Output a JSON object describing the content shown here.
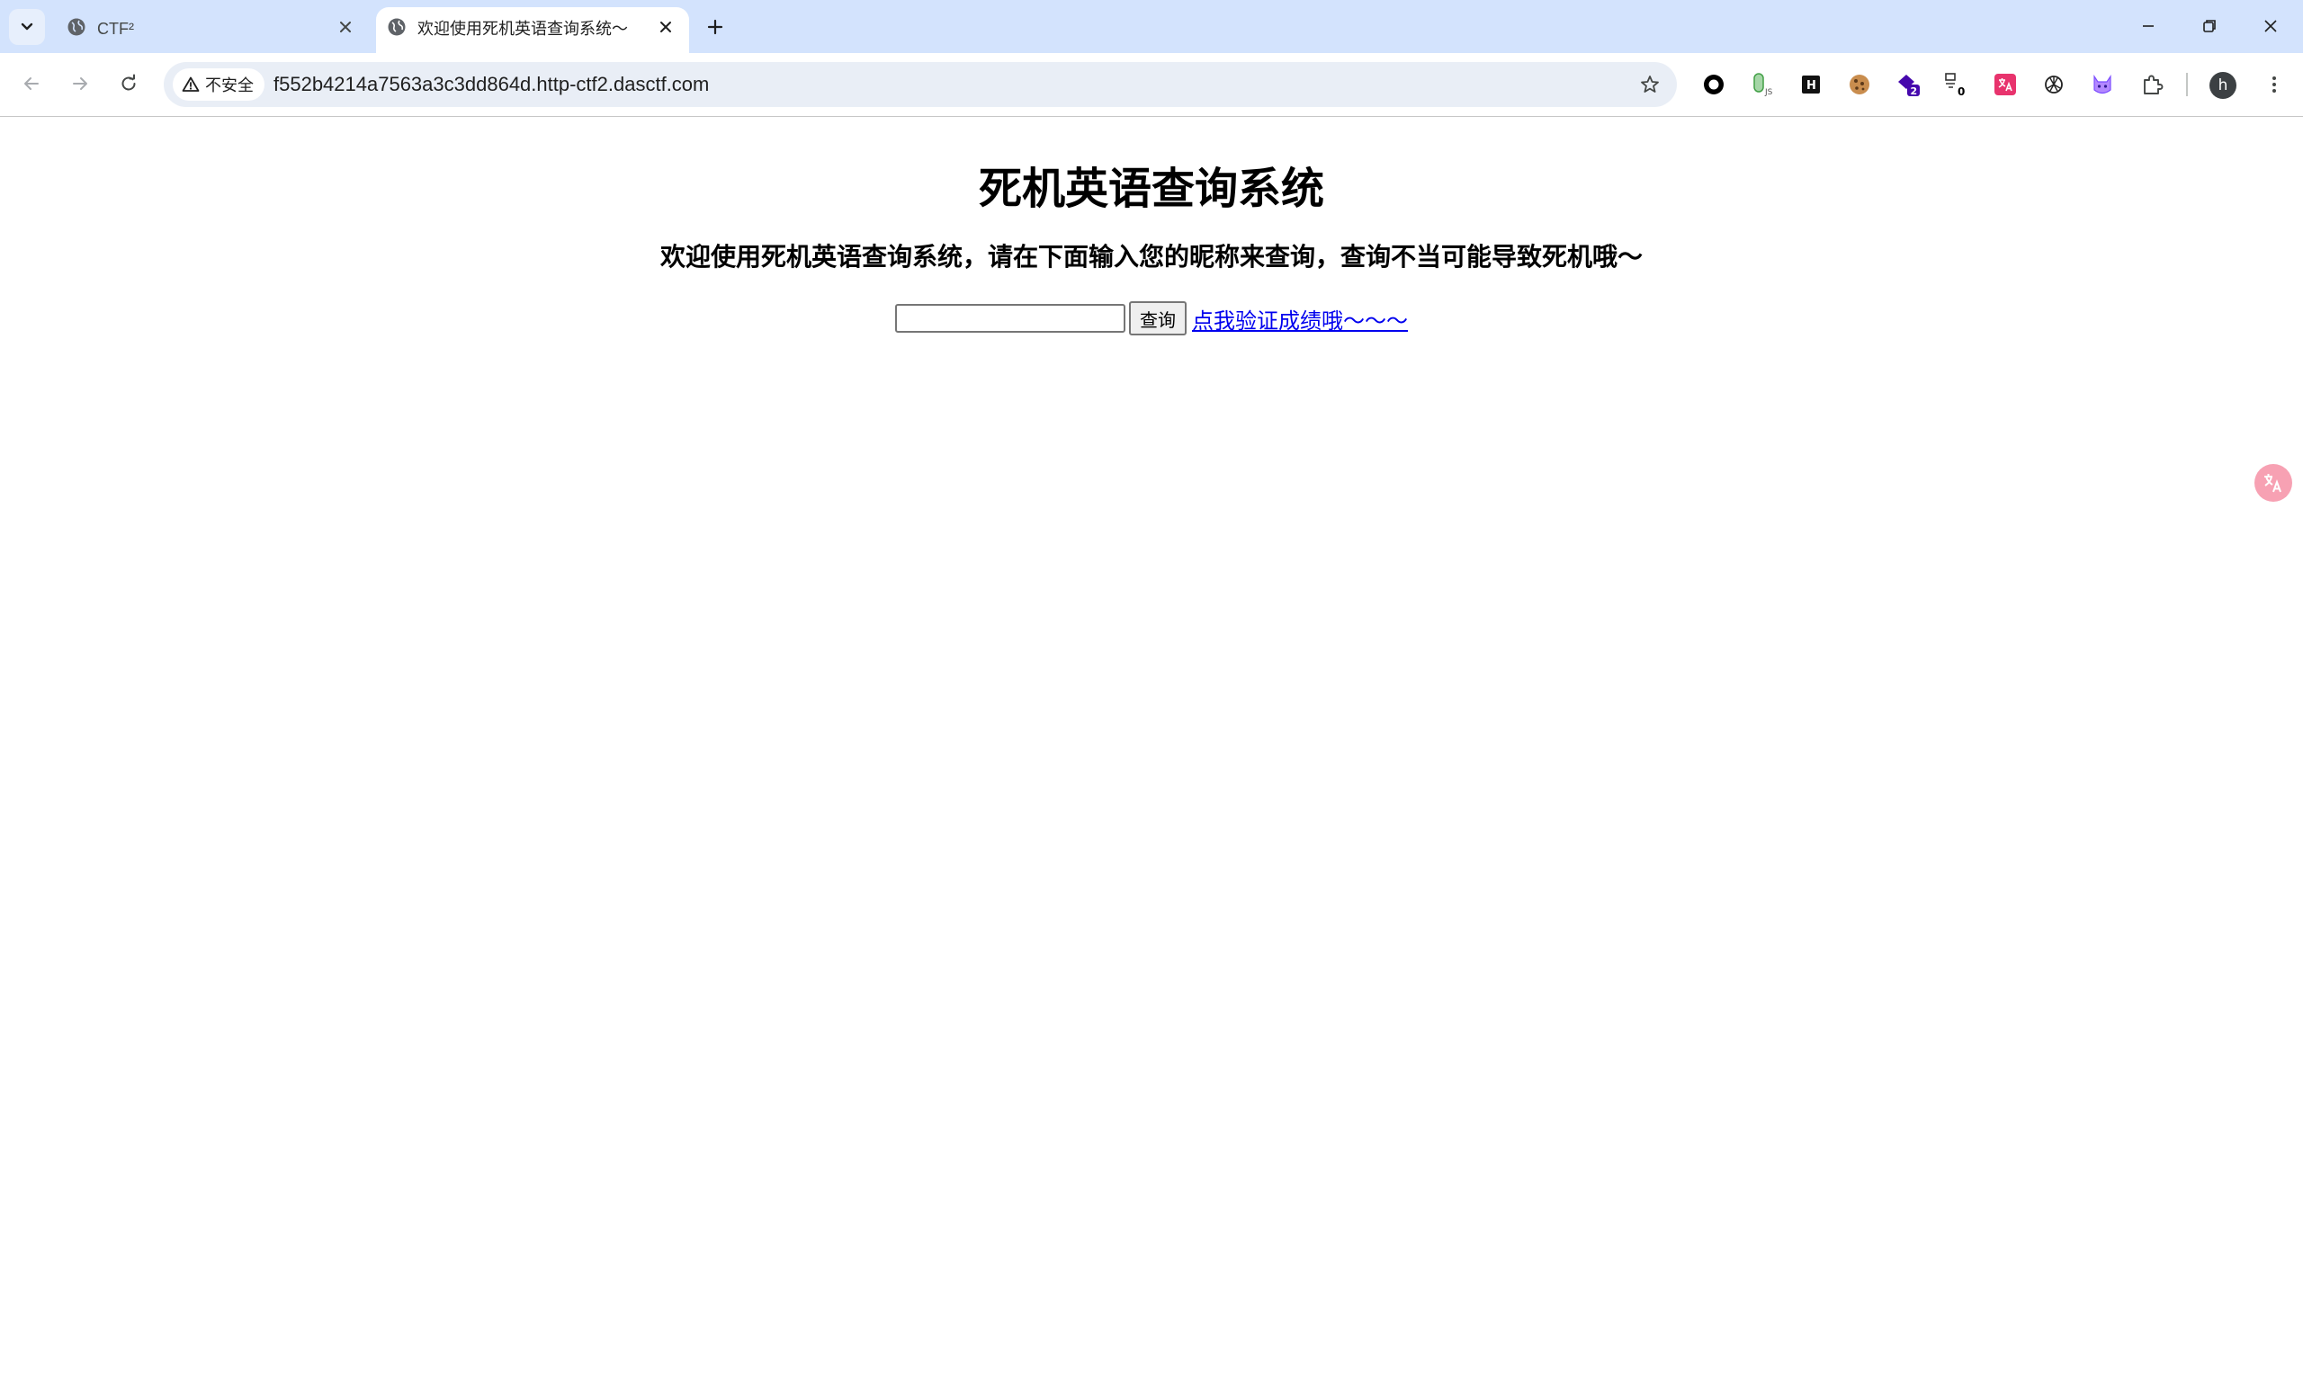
{
  "browser": {
    "tabs": [
      {
        "title": "CTF²",
        "active": false,
        "icon": "globe-icon"
      },
      {
        "title": "欢迎使用死机英语查询系统～",
        "active": true,
        "icon": "globe-icon"
      }
    ],
    "address_bar": {
      "security_label": "不安全",
      "url": "f552b4214a7563a3c3dd864d.http-ctf2.dasctf.com"
    },
    "extensions": [
      {
        "icon": "circle-record-icon"
      },
      {
        "icon": "nodejs-icon"
      },
      {
        "icon": "hackbar-icon"
      },
      {
        "icon": "cookie-icon"
      },
      {
        "icon": "wappalyzer-icon",
        "badge": "2"
      },
      {
        "icon": "proxy-icon",
        "badge": "0"
      },
      {
        "icon": "translate-icon"
      },
      {
        "icon": "openai-icon"
      },
      {
        "icon": "cat-icon"
      },
      {
        "icon": "puzzle-extensions-icon"
      }
    ],
    "profile_initial": "h"
  },
  "page": {
    "heading": "死机英语查询系统",
    "subheading": "欢迎使用死机英语查询系统，请在下面输入您的昵称来查询，查询不当可能导致死机哦～",
    "search_input_value": "",
    "query_button": "查询",
    "verify_link": "点我验证成绩哦～～～"
  },
  "colors": {
    "tabstrip_bg": "#d3e3fd",
    "omnibox_bg": "#e9eef6",
    "link": "#0000ee"
  }
}
